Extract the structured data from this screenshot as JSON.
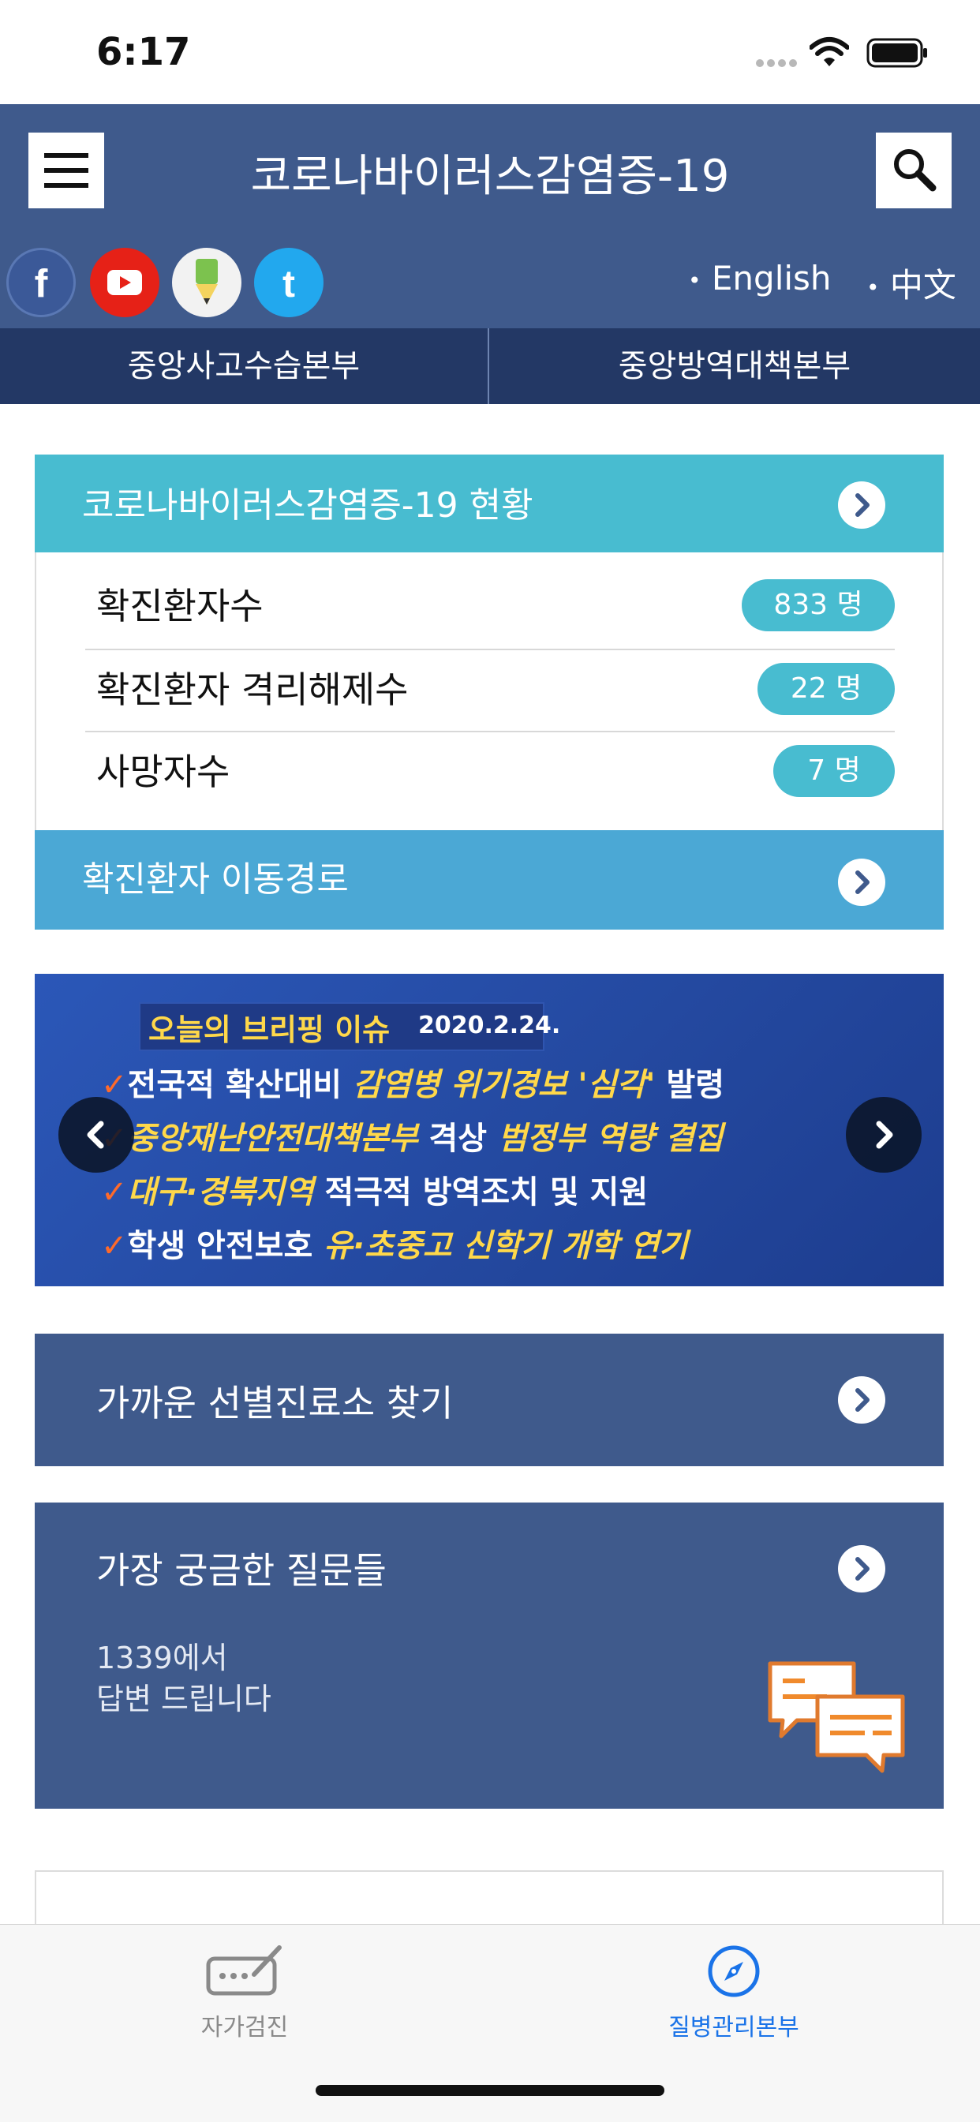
{
  "status_bar": {
    "time": "6:17"
  },
  "header": {
    "title": "코로나바이러스감염증-19",
    "social": [
      "facebook-icon",
      "youtube-icon",
      "blog-icon",
      "twitter-icon"
    ],
    "languages": [
      "English",
      "中文"
    ]
  },
  "subnav": {
    "items": [
      "중앙사고수습본부",
      "중앙방역대책본부"
    ]
  },
  "status_card": {
    "title": "코로나바이러스감염증-19 현황",
    "rows": [
      {
        "label": "확진환자수",
        "value": "833 명"
      },
      {
        "label": "확진환자 격리해제수",
        "value": "22 명"
      },
      {
        "label": "사망자수",
        "value": "7 명"
      }
    ],
    "route_title": "확진환자 이동경로"
  },
  "banner": {
    "heading": "오늘의 브리핑 이슈",
    "date": "2020.2.24.",
    "lines": [
      {
        "white": "전국적 확산대비 ",
        "yellow": "감염병 위기경보 '심각'",
        "white2": " 발령"
      },
      {
        "yellow": "중앙재난안전대책본부",
        "white": " 격상 ",
        "yellow2": "범정부 역량 결집"
      },
      {
        "yellow": "대구·경북지역",
        "white": " 적극적 방역조치 및 지원"
      },
      {
        "white": "학생 안전보호 ",
        "yellow": "유·초중고 신학기 개학 연기"
      }
    ]
  },
  "clinic": {
    "title": "가까운 선별진료소 찾기"
  },
  "faq": {
    "title": "가장 궁금한 질문들",
    "line1": "1339에서",
    "line2": "답변 드립니다"
  },
  "tabbar": {
    "tabs": [
      {
        "label": "자가검진",
        "icon": "self-check-icon",
        "active": false
      },
      {
        "label": "질병관리본부",
        "icon": "compass-icon",
        "active": true
      }
    ],
    "active_color": "#1a73e8"
  },
  "colors": {
    "header": "#3f5a8c",
    "subnav": "#233865",
    "teal": "#48bcd0",
    "route": "#4ba8d5",
    "pill": "#48bcd0"
  }
}
